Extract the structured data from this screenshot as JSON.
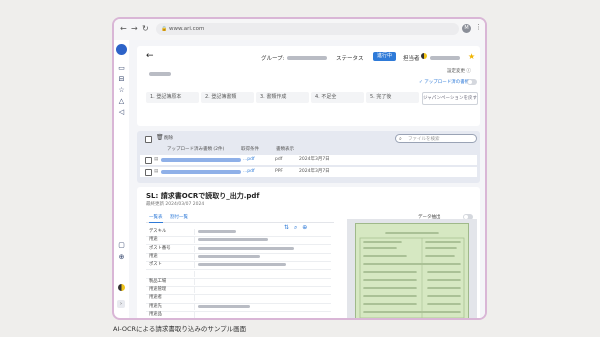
{
  "browser": {
    "url": "www.ari.com",
    "avatar_letter": "M",
    "back": "←",
    "forward": "→",
    "reload": "↻",
    "menu": "⋮"
  },
  "sidebar": {
    "icons": [
      "logo-icon",
      "inbox-icon",
      "tray-icon",
      "star-icon",
      "bell-icon",
      "megaphone-icon",
      "chat-icon",
      "globe-icon",
      "user-icon",
      "expand-icon"
    ]
  },
  "header": {
    "back_arrow": "←",
    "group_label": "グループ:",
    "status_label": "ステータス",
    "status_badge": "進行中",
    "owner_label": "担当者",
    "completion_link": "設定変更 ⓘ",
    "upload_link": "✓ アップロード済の書類",
    "reset_button": "ジャパンペーションを戻す",
    "steps": [
      "1. 登記簿原本",
      "2. 登記簿書類",
      "3. 書類作成",
      "4. 不足全",
      "5. 完了後"
    ]
  },
  "files": {
    "delete_label": "削除",
    "search_placeholder": "ファイルを検索",
    "columns": [
      "アップロード済み書類 (2件)",
      "取得条件",
      "書類表示"
    ],
    "rows": [
      {
        "name_suffix": "...pdf",
        "kind": "pdf",
        "date": "2024年3月7日"
      },
      {
        "name_suffix": "...pdf",
        "kind": "PPF",
        "date": "2024年3月7日"
      }
    ]
  },
  "detail": {
    "title": "SL: 請求書OCRで読取り_出力.pdf",
    "date": "最終更新 2024/03/07 2024",
    "tabs": [
      "一覧表",
      "割付一覧"
    ],
    "data_extract_label": "データ抽出",
    "fields": [
      {
        "key": "デスキル"
      },
      {
        "key": "用途"
      },
      {
        "key": "ポスト番号"
      },
      {
        "key": "用途"
      },
      {
        "key": "ポスト"
      },
      {
        "key": ""
      },
      {
        "key": "製品工場"
      },
      {
        "key": "用途管理"
      },
      {
        "key": "用途者"
      },
      {
        "key": "用途先"
      },
      {
        "key": "用途品"
      }
    ]
  },
  "caption": "AI-OCRによる請求書取り込みのサンプル画面"
}
